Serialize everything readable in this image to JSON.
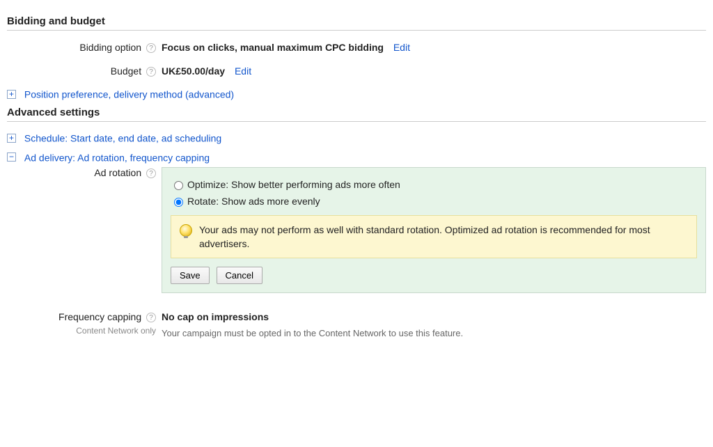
{
  "bidding_section": {
    "header": "Bidding and budget",
    "bidding_option_label": "Bidding option",
    "bidding_option_value": "Focus on clicks, manual maximum CPC bidding",
    "bidding_option_edit": "Edit",
    "budget_label": "Budget",
    "budget_value": "UK£50.00/day",
    "budget_edit": "Edit",
    "position_pref_link": "Position preference, delivery method (advanced)"
  },
  "advanced_section": {
    "header": "Advanced settings",
    "schedule_link": "Schedule: Start date, end date, ad scheduling",
    "ad_delivery_link": "Ad delivery: Ad rotation, frequency capping",
    "ad_rotation_label": "Ad rotation",
    "option_optimize": "Optimize: Show better performing ads more often",
    "option_rotate": "Rotate: Show ads more evenly",
    "hint_text": "Your ads may not perform as well with standard rotation. Optimized ad rotation is recommended for most advertisers.",
    "save_label": "Save",
    "cancel_label": "Cancel",
    "freq_label": "Frequency capping",
    "freq_sub": "Content Network only",
    "freq_value": "No cap on impressions",
    "freq_desc": "Your campaign must be opted in to the Content Network to use this feature."
  }
}
